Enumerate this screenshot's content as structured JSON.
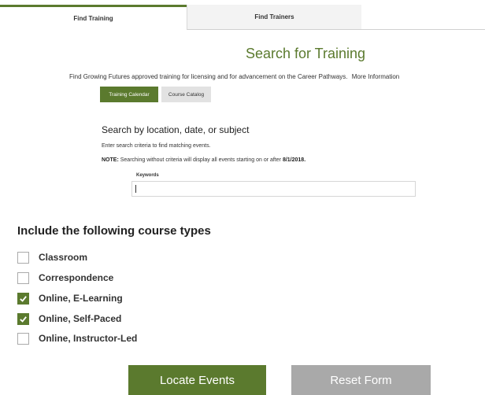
{
  "tabs": [
    {
      "label": "Find Training",
      "active": true
    },
    {
      "label": "Find Trainers",
      "active": false
    }
  ],
  "page_title": "Search for Training",
  "subtitle": {
    "text": "Find Growing Futures approved training for licensing and for advancement on the Career Pathways.",
    "link": "More Information"
  },
  "view_buttons": {
    "calendar": "Training Calendar",
    "catalog": "Course Catalog"
  },
  "search": {
    "heading": "Search by location, date, or subject",
    "help": "Enter search criteria to find matching events.",
    "note_label": "NOTE:",
    "note_text": "Searching without criteria will display all events starting on or after",
    "note_date": "8/1/2018.",
    "keywords_label": "Keywords",
    "keywords_value": ""
  },
  "course_types": {
    "heading": "Include the following course types",
    "items": [
      {
        "label": "Classroom",
        "checked": false
      },
      {
        "label": "Correspondence",
        "checked": false
      },
      {
        "label": "Online, E-Learning",
        "checked": true
      },
      {
        "label": "Online, Self-Paced",
        "checked": true
      },
      {
        "label": "Online, Instructor-Led",
        "checked": false
      }
    ]
  },
  "actions": {
    "locate": "Locate Events",
    "reset": "Reset Form"
  },
  "colors": {
    "accent": "#5b7a2e",
    "secondary_button": "#a9a9a9"
  }
}
